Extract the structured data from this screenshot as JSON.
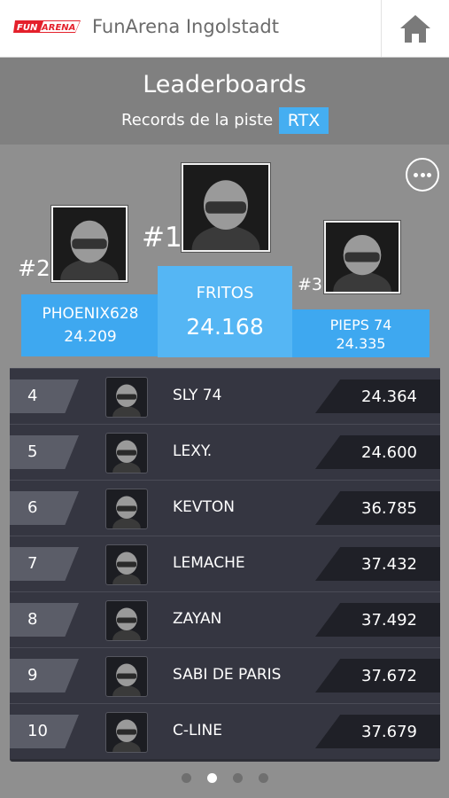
{
  "app": {
    "title": "FunArena Ingolstadt",
    "logo_text": "FUNARENA",
    "logo_subtext": "INGOLSTADT"
  },
  "nav": {
    "home_icon": "home-icon",
    "more_icon": "more-options-icon"
  },
  "header": {
    "title": "Leaderboards",
    "subtitle": "Records de la piste",
    "track": "RTX"
  },
  "podium": {
    "first": {
      "rank": "#1",
      "name": "FRITOS",
      "time": "24.168"
    },
    "second": {
      "rank": "#2",
      "name": "PHOENIX628",
      "time": "24.209"
    },
    "third": {
      "rank": "#3",
      "name": "PIEPS 74",
      "time": "24.335"
    }
  },
  "rows": [
    {
      "rank": "4",
      "name": "SLY 74",
      "time": "24.364"
    },
    {
      "rank": "5",
      "name": "LEXY.",
      "time": "24.600"
    },
    {
      "rank": "6",
      "name": "KEVTON",
      "time": "36.785"
    },
    {
      "rank": "7",
      "name": "LEMACHE",
      "time": "37.432"
    },
    {
      "rank": "8",
      "name": "ZAYAN",
      "time": "37.492"
    },
    {
      "rank": "9",
      "name": "SABI DE PARIS",
      "time": "37.672"
    },
    {
      "rank": "10",
      "name": "C-LINE",
      "time": "37.679"
    }
  ],
  "pager": {
    "active": 1,
    "count": 4
  },
  "colors": {
    "accent": "#45aef1",
    "background": "#8f8f8f",
    "board": "#2c2d35"
  }
}
